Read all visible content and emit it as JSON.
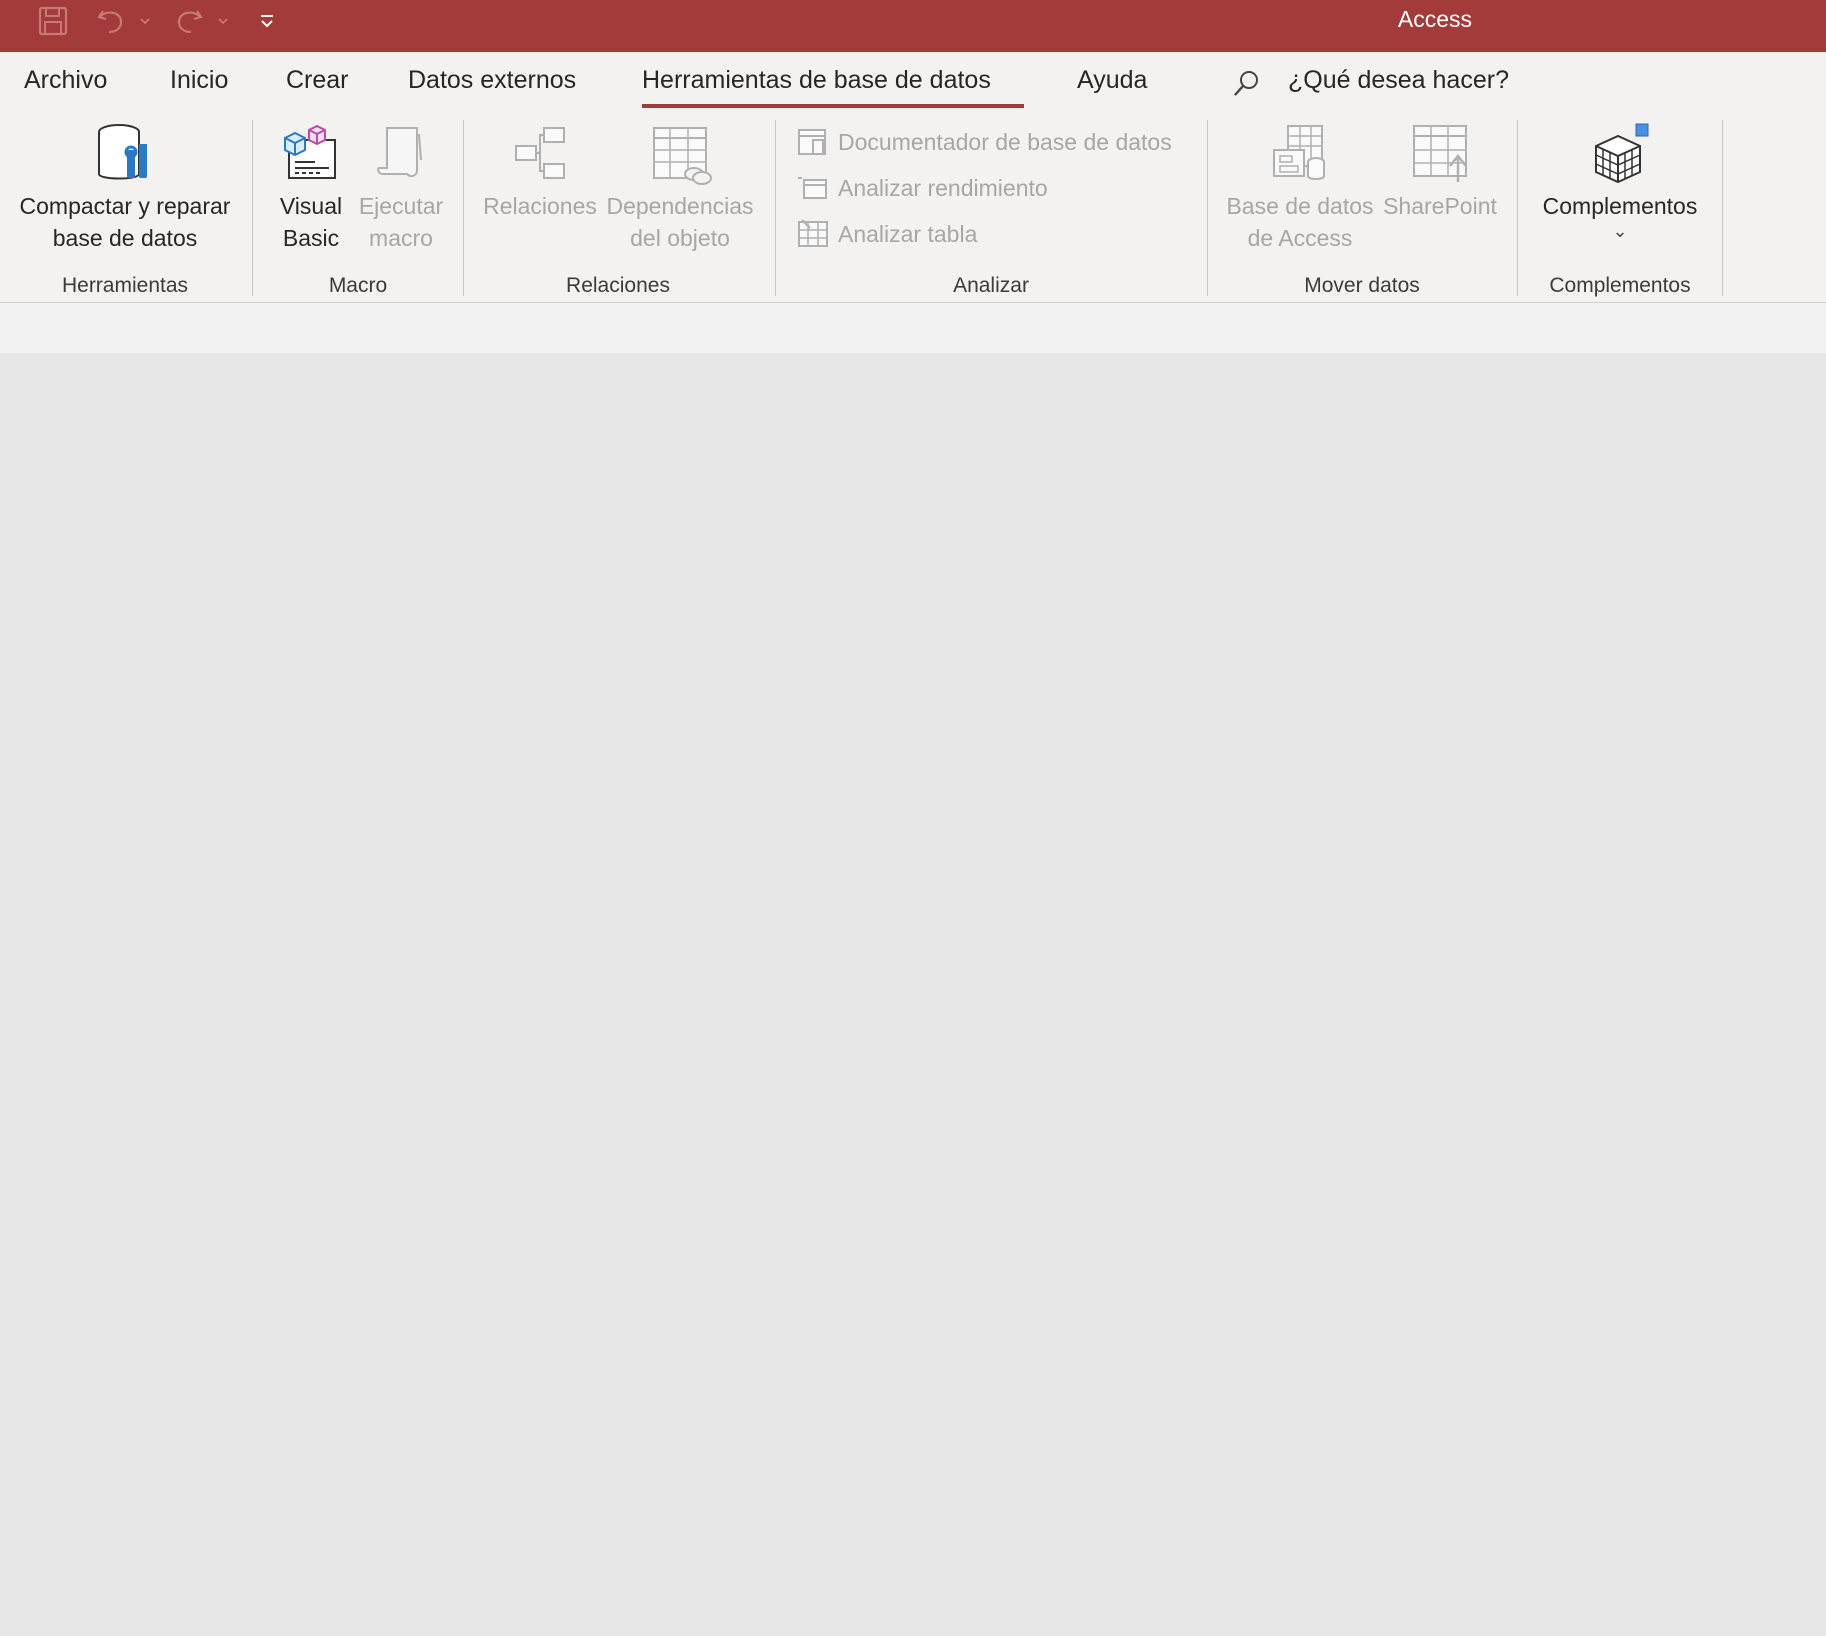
{
  "window": {
    "app_title": "Access"
  },
  "quick_access": [
    {
      "icon": "save-icon"
    },
    {
      "icon": "undo-icon"
    },
    {
      "icon": "redo-icon"
    },
    {
      "icon": "customize-qat-icon"
    }
  ],
  "tabs": [
    {
      "label": "Archivo"
    },
    {
      "label": "Inicio"
    },
    {
      "label": "Crear"
    },
    {
      "label": "Datos externos"
    },
    {
      "label": "Herramientas de base de datos",
      "active": true
    },
    {
      "label": "Ayuda"
    }
  ],
  "tell_me": {
    "placeholder": "¿Qué desea hacer?",
    "icon": "search-icon"
  },
  "ribbon": {
    "groups": {
      "herramientas": {
        "label": "Herramientas",
        "compact": {
          "line1": "Compactar y reparar",
          "line2": "base de datos",
          "icon": "compact-repair-icon"
        }
      },
      "macro": {
        "label": "Macro",
        "visual_basic": {
          "line1": "Visual",
          "line2": "Basic",
          "icon": "visual-basic-icon"
        },
        "run_macro": {
          "line1": "Ejecutar",
          "line2": "macro",
          "icon": "run-macro-icon",
          "disabled": true
        }
      },
      "relaciones": {
        "label": "Relaciones",
        "relaciones": {
          "line1": "Relaciones",
          "icon": "relationships-icon",
          "disabled": true
        },
        "dependencias": {
          "line1": "Dependencias",
          "line2": "del objeto",
          "icon": "object-dependencies-icon",
          "disabled": true
        }
      },
      "analizar": {
        "label": "Analizar",
        "documentador": {
          "label": "Documentador de base de datos",
          "icon": "documenter-icon",
          "disabled": true
        },
        "rendimiento": {
          "label": "Analizar rendimiento",
          "icon": "analyze-performance-icon",
          "disabled": true
        },
        "tabla": {
          "label": "Analizar tabla",
          "icon": "analyze-table-icon",
          "disabled": true
        }
      },
      "mover_datos": {
        "label": "Mover datos",
        "access_db": {
          "line1": "Base de datos",
          "line2": "de Access",
          "icon": "access-database-icon",
          "disabled": true
        },
        "sharepoint": {
          "line1": "SharePoint",
          "icon": "sharepoint-icon",
          "disabled": true
        }
      },
      "complementos": {
        "label": "Complementos",
        "complementos": {
          "line1": "Complementos",
          "icon": "add-ins-icon",
          "caret": "⌄"
        }
      }
    }
  },
  "colors": {
    "title_bar": "#a33b3b",
    "ribbon_bg": "#f3f2f1",
    "workspace_bg": "#e6e6e6",
    "accent": "#a33b3b"
  }
}
